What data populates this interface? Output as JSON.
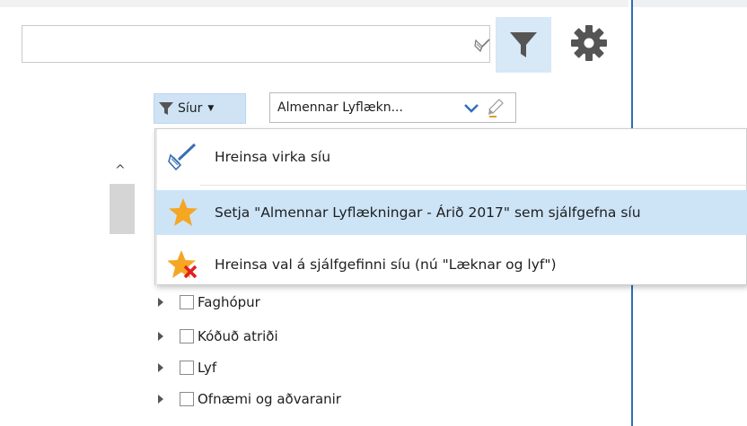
{
  "toolbar": {
    "search_value": "",
    "clear_search_icon": "broom-icon",
    "filter_icon": "filter-icon",
    "settings_icon": "gear-icon"
  },
  "filter_bar": {
    "siur_label": "Síur",
    "selected_filter": "Almennar Lyflækn...",
    "dropdown_icon": "chevron-down-icon",
    "edit_icon": "pencil-icon"
  },
  "menu": {
    "items": [
      {
        "label": "Hreinsa virka síu",
        "icon": "broom-icon"
      },
      {
        "label": "Setja \"Almennar Lyflækningar - Árið 2017\" sem sjálfgefna síu",
        "icon": "star-icon"
      },
      {
        "label": "Hreinsa val á sjálfgefinni síu (nú \"Læknar og lyf\")",
        "icon": "star-remove-icon"
      }
    ]
  },
  "tree": {
    "items": [
      {
        "label": "Faghópur"
      },
      {
        "label": "Kóðuð atriði"
      },
      {
        "label": "Lyf"
      },
      {
        "label": "Ofnæmi og aðvaranir"
      }
    ]
  },
  "colors": {
    "accent": "#2f6db8",
    "selected_bg": "#cde4f7",
    "filter_button_bg": "#d7e8f7",
    "star": "#f5a623"
  }
}
